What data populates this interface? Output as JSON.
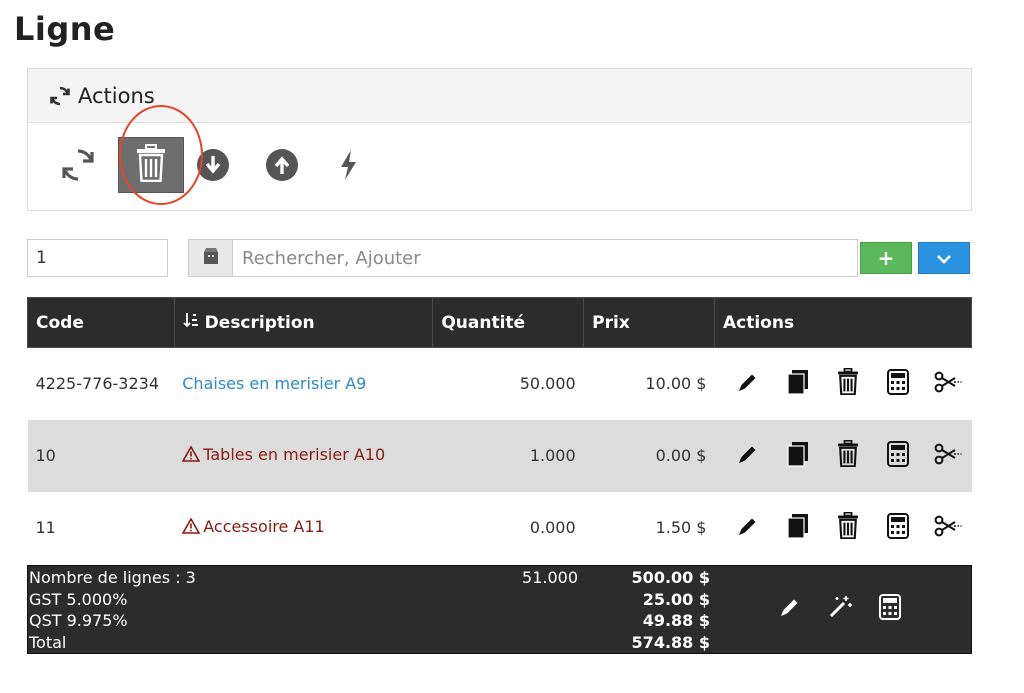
{
  "page": {
    "title": "Ligne"
  },
  "actions_panel": {
    "title": "Actions",
    "buttons": [
      {
        "name": "refresh",
        "icon": "refresh-icon",
        "active": false
      },
      {
        "name": "delete",
        "icon": "trash-icon",
        "active": true
      },
      {
        "name": "download",
        "icon": "circle-arrow-down-icon",
        "active": false
      },
      {
        "name": "upload",
        "icon": "circle-arrow-up-icon",
        "active": false
      },
      {
        "name": "flash",
        "icon": "lightning-icon",
        "active": false
      }
    ],
    "highlight_color": "#e2462b"
  },
  "entry": {
    "quantity_value": "1",
    "search_placeholder": "Rechercher, Ajouter",
    "add_label": "+"
  },
  "table": {
    "columns": [
      "Code",
      "Description",
      "Quantité",
      "Prix",
      "Actions"
    ],
    "sort_column": "Description",
    "rows": [
      {
        "code": "4225-776-3234",
        "description": "Chaises en merisier A9",
        "warning": false,
        "quantity": "50.000",
        "price": "10.00 $"
      },
      {
        "code": "10",
        "description": "Tables en merisier A10",
        "warning": true,
        "quantity": "1.000",
        "price": "0.00 $"
      },
      {
        "code": "11",
        "description": "Accessoire A11",
        "warning": true,
        "quantity": "0.000",
        "price": "1.50 $"
      }
    ],
    "row_action_icons": [
      "pencil-icon",
      "copy-icon",
      "trash-icon",
      "calculator-icon",
      "scissors-icon"
    ]
  },
  "footer": {
    "line_count_label": "Nombre de lignes : 3",
    "gst_label": "GST 5.000%",
    "qst_label": "QST 9.975%",
    "total_label": "Total",
    "total_quantity": "51.000",
    "subtotal": "500.00 $",
    "gst_amount": "25.00 $",
    "qst_amount": "49.88 $",
    "total_amount": "574.88 $",
    "action_icons": [
      "pencil-icon",
      "magic-wand-icon",
      "calculator-icon"
    ]
  },
  "colors": {
    "link": "#2b8ac6",
    "warning": "#8b1a10",
    "header_bg": "#2c2c2c",
    "add_button": "#5cb85c",
    "dropdown_button": "#2c93e0"
  }
}
